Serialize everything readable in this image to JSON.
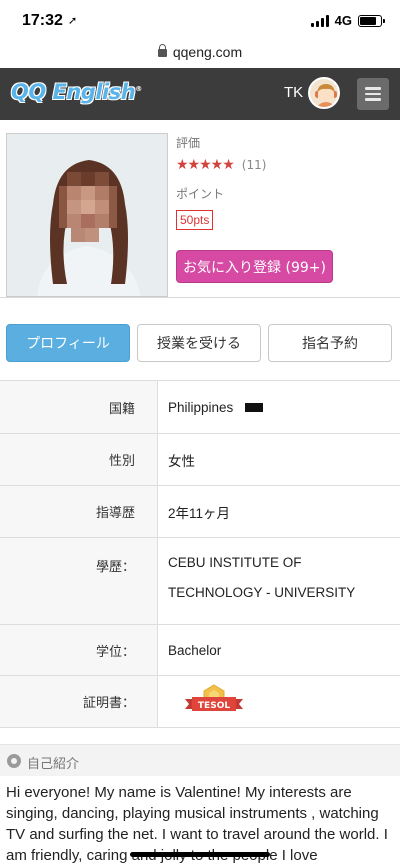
{
  "status_bar": {
    "time": "17:32",
    "network": "4G",
    "battery_level": 0.8
  },
  "browser": {
    "url": "qqeng.com"
  },
  "header": {
    "logo_text": "QQ English",
    "logo_mark": "®",
    "user_name": "TK",
    "brand_color": "#5ab4ea"
  },
  "teacher": {
    "rating_label": "評価",
    "stars": "★★★★★",
    "rating_count": "(11)",
    "rating_value": 5,
    "points_label": "ポイント",
    "points": "50pts",
    "favorite_button": "お気に入り登録 (99+)"
  },
  "tabs": [
    {
      "label": "プロフィール",
      "active": true
    },
    {
      "label": "授業を受ける",
      "active": false
    },
    {
      "label": "指名予約",
      "active": false
    }
  ],
  "details": {
    "nationality_label": "国籍",
    "nationality_value": "Philippines",
    "gender_label": "性別",
    "gender_value": "女性",
    "experience_label": "指導歴",
    "experience_value": "2年11ヶ月",
    "education_label": "學歷：",
    "education_line1": "CEBU INSTITUTE OF",
    "education_line2": "TECHNOLOGY - UNIVERSITY",
    "degree_label": "学位：",
    "degree_value": "Bachelor",
    "certificate_label": "証明書：",
    "certificate_badge": "TESOL"
  },
  "intro": {
    "title": "自己紹介",
    "text": "Hi everyone! My name is Valentine! My interests are singing, dancing, playing musical instruments , watching TV and surfing the net. I want to travel around the world. I am friendly, caring and jolly to the people I love"
  }
}
